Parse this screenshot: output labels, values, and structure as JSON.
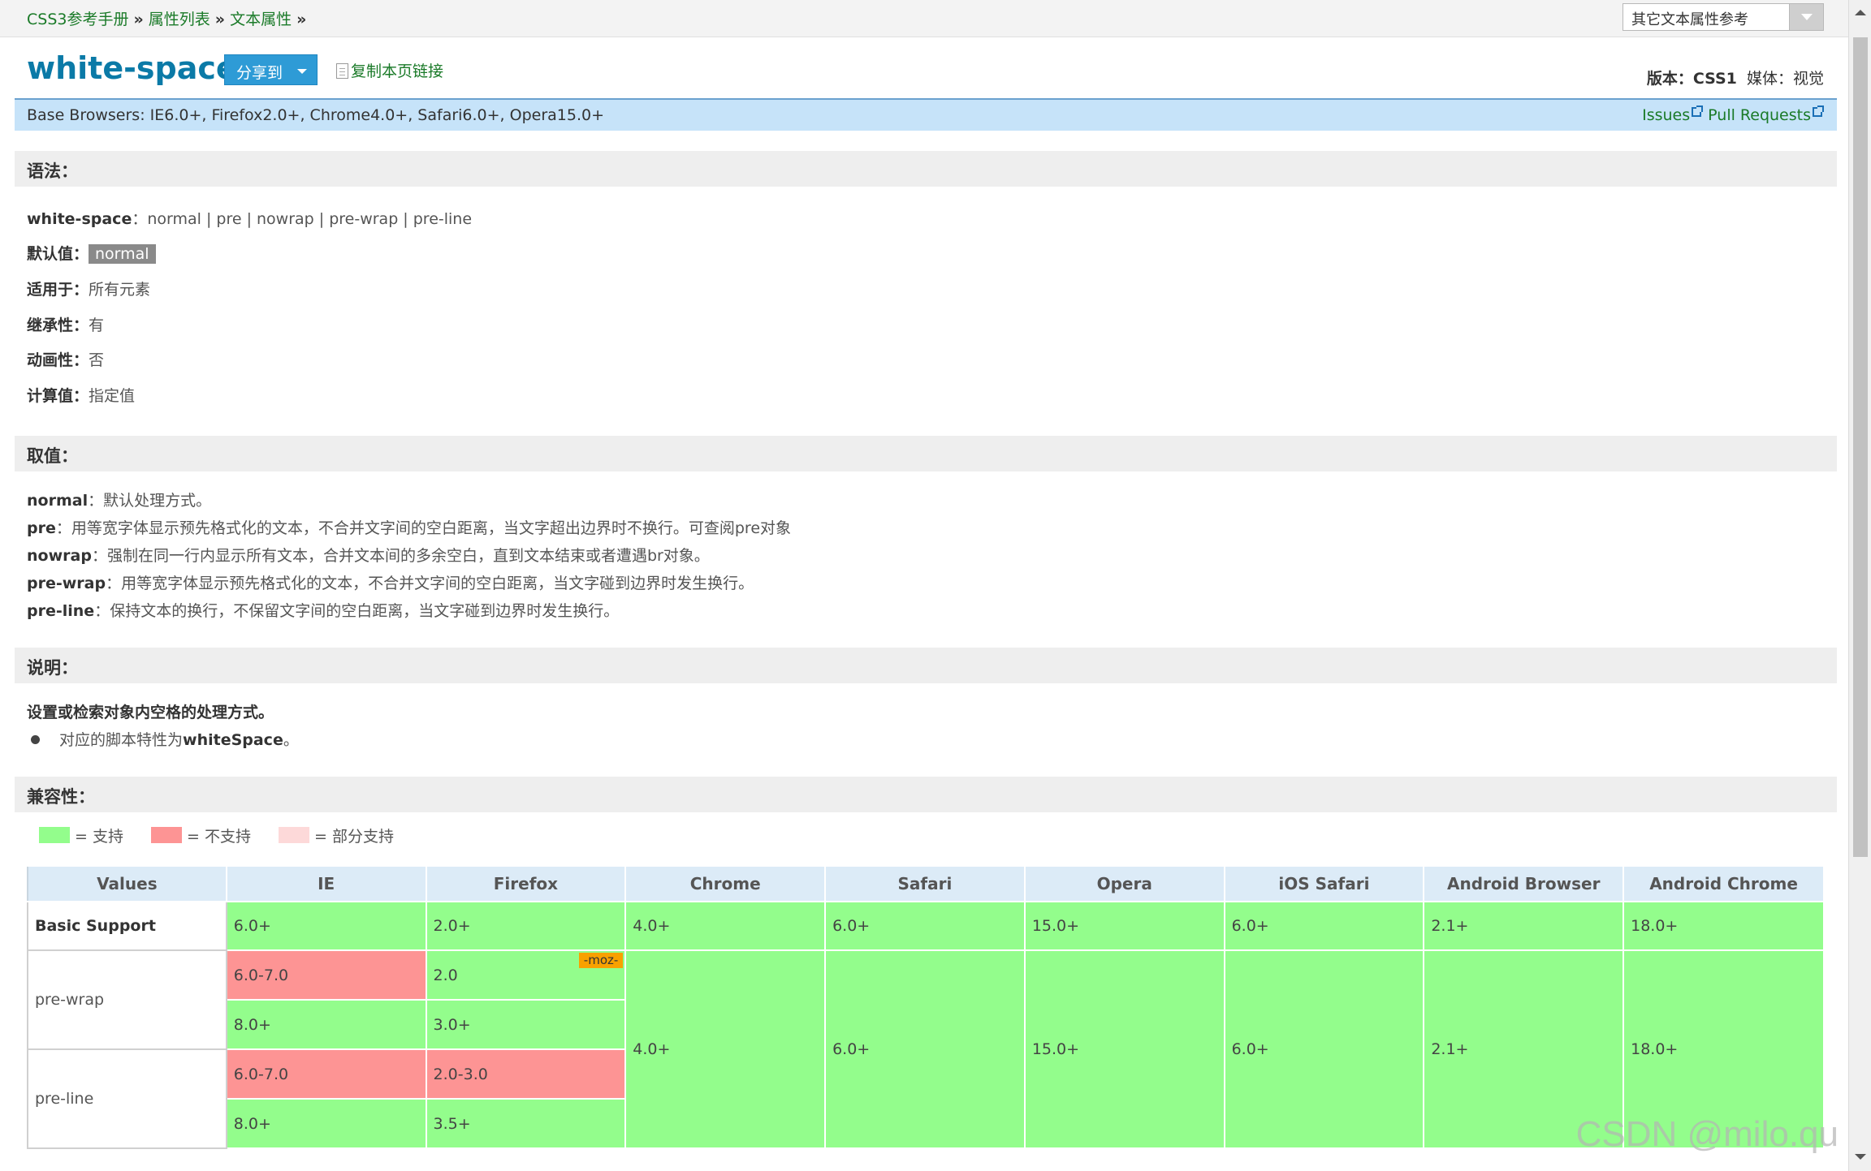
{
  "breadcrumb": {
    "items": [
      "CSS3参考手册",
      "属性列表",
      "文本属性"
    ],
    "separator": "»"
  },
  "top_select": {
    "value": "其它文本属性参考"
  },
  "header": {
    "title": "white-space",
    "share_label": "分享到",
    "copy_link_label": "复制本页链接",
    "version_label": "版本：",
    "version_value": "CSS1",
    "media_label": "媒体：",
    "media_value": "视觉"
  },
  "browsers_bar": {
    "text": "Base Browsers: IE6.0+, Firefox2.0+, Chrome4.0+, Safari6.0+, Opera15.0+",
    "issues": "Issues",
    "pull_requests": "Pull Requests"
  },
  "syntax": {
    "heading": "语法：",
    "property": "white-space",
    "values_text": "：normal | pre | nowrap | pre-wrap | pre-line",
    "default_label": "默认值：",
    "default_value": "normal",
    "applies_label": "适用于：",
    "applies_value": "所有元素",
    "inherited_label": "继承性：",
    "inherited_value": "有",
    "animatable_label": "动画性：",
    "animatable_value": "否",
    "computed_label": "计算值：",
    "computed_value": "指定值"
  },
  "values_section": {
    "heading": "取值：",
    "items": [
      {
        "name": "normal",
        "desc": "：默认处理方式。"
      },
      {
        "name": "pre",
        "desc": "：用等宽字体显示预先格式化的文本，不合并文字间的空白距离，当文字超出边界时不换行。可查阅pre对象"
      },
      {
        "name": "nowrap",
        "desc": "：强制在同一行内显示所有文本，合并文本间的多余空白，直到文本结束或者遭遇br对象。"
      },
      {
        "name": "pre-wrap",
        "desc": "：用等宽字体显示预先格式化的文本，不合并文字间的空白距离，当文字碰到边界时发生换行。"
      },
      {
        "name": "pre-line",
        "desc": "：保持文本的换行，不保留文字间的空白距离，当文字碰到边界时发生换行。"
      }
    ]
  },
  "description": {
    "heading": "说明：",
    "main": "设置或检索对象内空格的处理方式。",
    "bullet_prefix": "对应的脚本特性为",
    "bullet_bold": "whiteSpace",
    "bullet_suffix": "。"
  },
  "compatibility": {
    "heading": "兼容性：",
    "legend": [
      {
        "color": "#93fd8c",
        "label": "= 支持"
      },
      {
        "color": "#fd9494",
        "label": "= 不支持"
      },
      {
        "color": "#fdd9d9",
        "label": "= 部分支持"
      }
    ],
    "columns": [
      "Values",
      "IE",
      "Firefox",
      "Chrome",
      "Safari",
      "Opera",
      "iOS Safari",
      "Android Browser",
      "Android Chrome"
    ],
    "basic": {
      "label": "Basic Support",
      "values": [
        "6.0+",
        "2.0+",
        "4.0+",
        "6.0+",
        "15.0+",
        "6.0+",
        "2.1+",
        "18.0+"
      ]
    },
    "pre_wrap": {
      "label": "pre-wrap",
      "ie": [
        "6.0-7.0",
        "8.0+"
      ],
      "firefox": [
        "2.0",
        "3.0+"
      ],
      "firefox_prefix": "-moz-"
    },
    "pre_line": {
      "label": "pre-line",
      "ie": [
        "6.0-7.0",
        "8.0+"
      ],
      "firefox": [
        "2.0-3.0",
        "3.5+"
      ]
    },
    "merged": {
      "chrome": "4.0+",
      "safari": "6.0+",
      "opera": "15.0+",
      "ios_safari": "6.0+",
      "android_browser": "2.1+",
      "android_chrome": "18.0+"
    }
  },
  "watermark": "CSDN @milo.qu",
  "colors": {
    "green": "#93fd8c",
    "red": "#fd9494",
    "partial": "#fdd9d9",
    "title": "#0b7aa7",
    "link": "#1a7a28"
  }
}
